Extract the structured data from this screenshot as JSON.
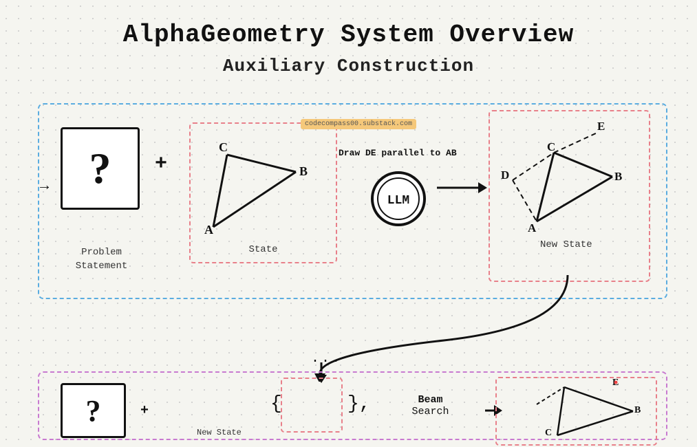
{
  "title": "AlphaGeometry System Overview",
  "subtitle": "Auxiliary Construction",
  "watermark": "codecompass00.substack.com",
  "llm_instruction": "Draw DE parallel to AB",
  "llm_label": "LLM",
  "problem_label": "Problem\nStatement",
  "state_label": "State",
  "new_state_label": "New State",
  "new_state_bottom_label": "New State",
  "beam_search_label1": "Beam",
  "beam_search_label2": "Search",
  "plus_sign": "+",
  "arrow_left": "→",
  "dots": "...",
  "triangle_vertices": {
    "state": {
      "A": "A",
      "B": "B",
      "C": "C"
    },
    "new_state": {
      "A": "A",
      "B": "B",
      "C": "C",
      "D": "D",
      "E": "E"
    }
  }
}
